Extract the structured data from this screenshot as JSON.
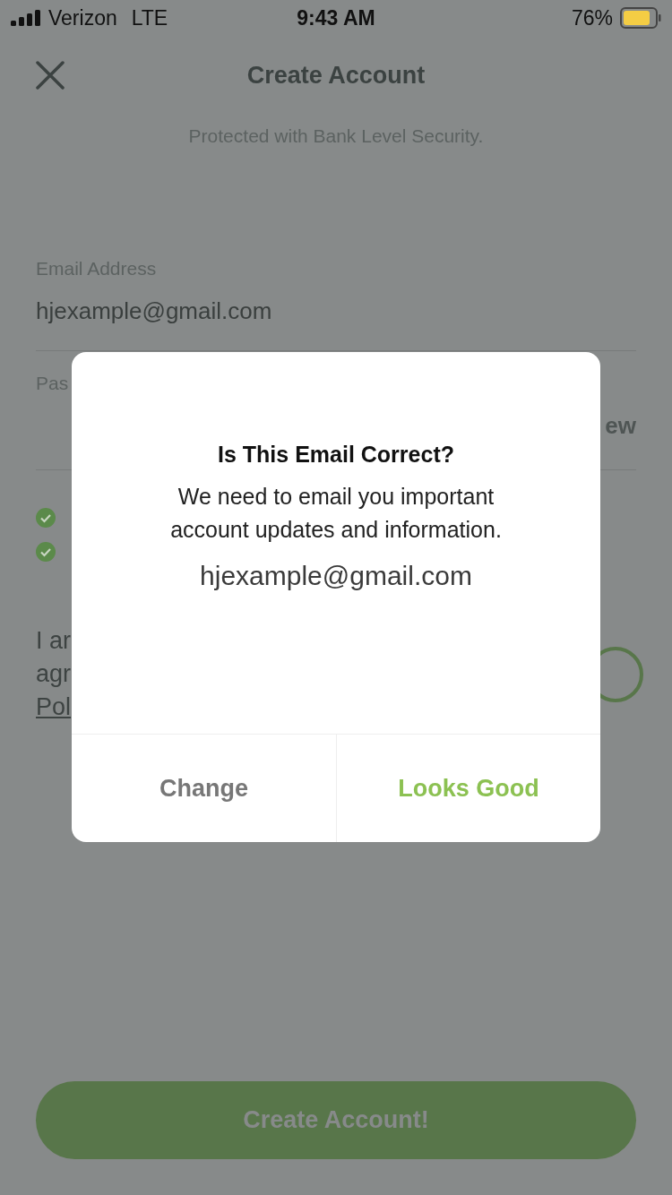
{
  "status_bar": {
    "carrier": "Verizon",
    "network": "LTE",
    "time": "9:43 AM",
    "battery": "76%"
  },
  "header": {
    "title": "Create Account",
    "subtitle": "Protected with Bank Level Security."
  },
  "form": {
    "email": {
      "label": "Email Address",
      "value": "hjexample@gmail.com"
    },
    "password": {
      "label": "Pas",
      "toggle": "ew"
    },
    "requirements": [
      {
        "met": true
      },
      {
        "met": true
      }
    ],
    "agreement": {
      "lines": [
        "I ar",
        "agr"
      ],
      "link": "Pol"
    }
  },
  "dialog": {
    "title": "Is This Email Correct?",
    "message": "We need to email you important account updates and information.",
    "email": "hjexample@gmail.com",
    "buttons": [
      {
        "label": "Change",
        "kind": "secondary"
      },
      {
        "label": "Looks Good",
        "kind": "primary"
      }
    ]
  },
  "submit": {
    "label": "Create Account!"
  }
}
